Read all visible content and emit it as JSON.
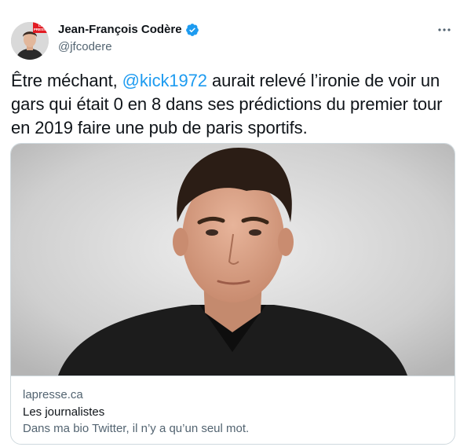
{
  "author": {
    "display_name": "Jean-François Codère",
    "handle": "@jfcodere",
    "avatar_badge": "LA PRESSE",
    "verified": true
  },
  "tweet": {
    "text_before": "Être méchant, ",
    "mention": "@kick1972",
    "text_after": " aurait relevé l’ironie de voir un gars qui était 0 en 8 dans ses prédictions du premier tour en 2019 faire une pub de paris sportifs."
  },
  "card": {
    "domain": "lapresse.ca",
    "title": "Les journalistes",
    "description": "Dans ma bio Twitter, il n’y a qu’un seul mot."
  },
  "colors": {
    "accent": "#1d9bf0",
    "secondary_text": "#536471",
    "border": "#cfd9de",
    "badge_red": "#e21b23"
  },
  "icons": {
    "verified": "verified-badge-icon",
    "more": "more-dots-icon"
  }
}
